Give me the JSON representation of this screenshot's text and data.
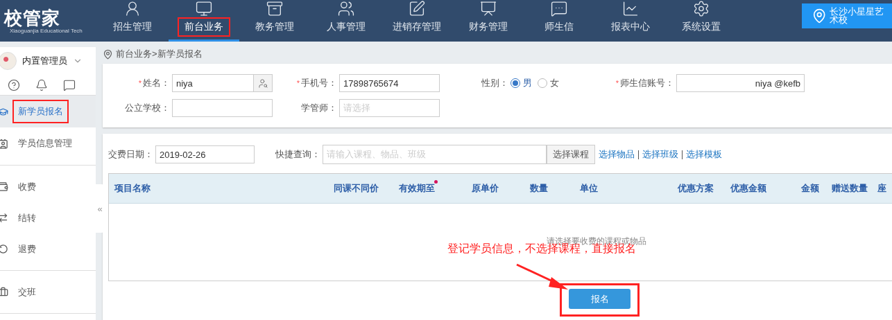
{
  "logo": {
    "name": "校管家",
    "tagline": "Xiaoguanjia Educational Tech"
  },
  "nav": [
    {
      "label": "招生管理",
      "kind": "recruit",
      "selected": false,
      "highlighted": false
    },
    {
      "label": "前台业务",
      "kind": "desk",
      "selected": true,
      "highlighted": true
    },
    {
      "label": "教务管理",
      "kind": "box",
      "selected": false,
      "highlighted": false
    },
    {
      "label": "人事管理",
      "kind": "people",
      "selected": false,
      "highlighted": false
    },
    {
      "label": "进销存管理",
      "kind": "edit",
      "selected": false,
      "highlighted": false
    },
    {
      "label": "财务管理",
      "kind": "finance",
      "selected": false,
      "highlighted": false
    },
    {
      "label": "师生信",
      "kind": "chat",
      "selected": false,
      "highlighted": false
    },
    {
      "label": "报表中心",
      "kind": "chart",
      "selected": false,
      "highlighted": false
    },
    {
      "label": "系统设置",
      "kind": "settings",
      "selected": false,
      "highlighted": false
    }
  ],
  "location": {
    "label": "长沙小星星艺术校"
  },
  "user": {
    "name": "内置管理员"
  },
  "sidebar": {
    "sections": [
      {
        "items": [
          {
            "label": "新学员报名",
            "kind": "cap",
            "selected": true,
            "highlighted": true
          },
          {
            "label": "学员信息管理",
            "kind": "card",
            "selected": false,
            "highlighted": false
          }
        ]
      },
      {
        "items": [
          {
            "label": "收费",
            "kind": "wallet",
            "selected": false,
            "highlighted": false
          },
          {
            "label": "结转",
            "kind": "transfer",
            "selected": false,
            "highlighted": false
          },
          {
            "label": "退费",
            "kind": "refund",
            "selected": false,
            "highlighted": false
          }
        ]
      },
      {
        "items": [
          {
            "label": "交班",
            "kind": "handover",
            "selected": false,
            "highlighted": false
          }
        ]
      }
    ]
  },
  "collapse": "«",
  "breadcrumb": "前台业务>新学员报名",
  "student_form": {
    "required_mark": "*",
    "name": {
      "label": "姓名：",
      "required": true,
      "value": "niya"
    },
    "phone": {
      "label": "手机号：",
      "required": true,
      "value": "17898765674"
    },
    "gender": {
      "label": "性别：",
      "options": [
        {
          "label": "男",
          "selected": true
        },
        {
          "label": "女",
          "selected": false
        }
      ]
    },
    "account": {
      "label": "师生信账号：",
      "required": true,
      "value": "niya @kefb"
    },
    "school": {
      "label": "公立学校："
    },
    "teacher": {
      "label": "学管师：",
      "placeholder": "请选择"
    }
  },
  "payment": {
    "date": {
      "label": "交费日期：",
      "value": "2019-02-26"
    },
    "quick": {
      "label": "快捷查询：",
      "placeholder": "请输入课程、物品、班级",
      "button": "选择课程"
    },
    "links": [
      "选择物品",
      "选择班级",
      "选择模板"
    ]
  },
  "table": {
    "columns": [
      {
        "label": "项目名称",
        "marked": false
      },
      {
        "label": "同课不同价",
        "marked": false
      },
      {
        "label": "有效期至",
        "marked": true
      },
      {
        "label": "原单价",
        "marked": false
      },
      {
        "label": "数量",
        "marked": false
      },
      {
        "label": "单位",
        "marked": false
      },
      {
        "label": "优惠方案",
        "marked": false
      },
      {
        "label": "优惠金额",
        "marked": false
      },
      {
        "label": "金额",
        "marked": false
      },
      {
        "label": "赠送数量",
        "marked": false
      },
      {
        "label": "座",
        "marked": false
      }
    ],
    "empty_message": "请选择要收费的课程或物品"
  },
  "submit": {
    "label": "报名",
    "highlighted": true
  },
  "annotation": {
    "text": "登记学员信息，不选择课程，直接报名"
  }
}
